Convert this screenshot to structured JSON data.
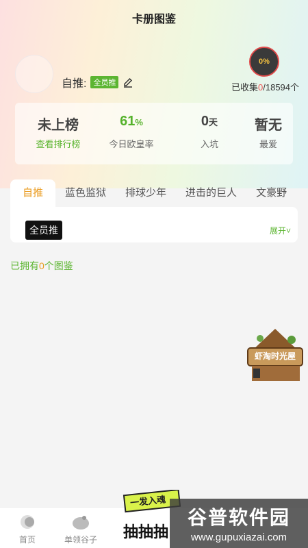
{
  "title": "卡册图鉴",
  "profile": {
    "zitui_label": "自推:",
    "member_tag": "全员推",
    "progress_text": "0%",
    "collected_prefix": "已收集",
    "collected_count": "0",
    "collected_total": "/18594个"
  },
  "stats": [
    {
      "value": "未上榜",
      "unit": "",
      "label": "查看排行榜"
    },
    {
      "value": "61",
      "unit": "%",
      "label": "今日欧皇率"
    },
    {
      "value": "0",
      "unit": "天",
      "label": "入坑"
    },
    {
      "value": "暂无",
      "unit": "",
      "label": "最爱"
    }
  ],
  "tabs": [
    "自推",
    "蓝色监狱",
    "排球少年",
    "进击的巨人",
    "文豪野"
  ],
  "filter": {
    "chip": "全员推",
    "expand": "展开"
  },
  "owned": {
    "prefix": "已拥有",
    "count": "0",
    "suffix": "个图鉴"
  },
  "float_badge": {
    "text": "虾淘时光屋"
  },
  "bottom_nav": [
    {
      "label": "首页"
    },
    {
      "label": "单领谷子"
    }
  ],
  "promo": {
    "top": "一发入魂",
    "main": "抽抽抽"
  },
  "watermark": {
    "big": "谷普软件园",
    "small": "www.gupuxiazai.com"
  },
  "colors": {
    "accent_green": "#5cb531",
    "accent_orange": "#ea9b1f",
    "red": "#e55555"
  }
}
